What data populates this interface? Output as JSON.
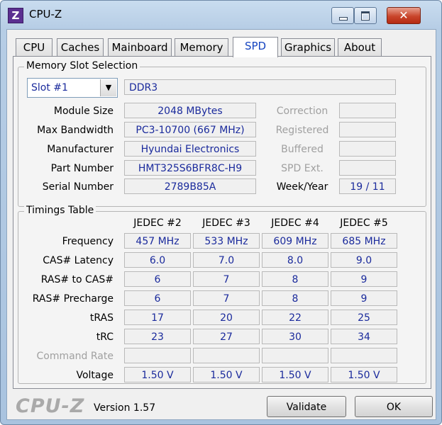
{
  "window": {
    "title": "CPU-Z",
    "icon_letter": "Z",
    "close_glyph": "✕"
  },
  "tabs": [
    "CPU",
    "Caches",
    "Mainboard",
    "Memory",
    "SPD",
    "Graphics",
    "About"
  ],
  "active_tab": "SPD",
  "slot_group": {
    "title": "Memory Slot Selection",
    "slot_selected": "Slot #1",
    "memory_type": "DDR3",
    "fields": [
      {
        "label": "Module Size",
        "value": "2048 MBytes"
      },
      {
        "label": "Max Bandwidth",
        "value": "PC3-10700 (667 MHz)"
      },
      {
        "label": "Manufacturer",
        "value": "Hyundai Electronics"
      },
      {
        "label": "Part Number",
        "value": "HMT325S6BFR8C-H9"
      },
      {
        "label": "Serial Number",
        "value": "2789B85A"
      }
    ],
    "right_fields": [
      {
        "label": "Correction",
        "value": ""
      },
      {
        "label": "Registered",
        "value": ""
      },
      {
        "label": "Buffered",
        "value": ""
      },
      {
        "label": "SPD Ext.",
        "value": ""
      },
      {
        "label": "Week/Year",
        "value": "19 / 11"
      }
    ]
  },
  "timings": {
    "title": "Timings Table",
    "columns": [
      "JEDEC #2",
      "JEDEC #3",
      "JEDEC #4",
      "JEDEC #5"
    ],
    "rows": [
      {
        "label": "Frequency",
        "values": [
          "457 MHz",
          "533 MHz",
          "609 MHz",
          "685 MHz"
        ]
      },
      {
        "label": "CAS# Latency",
        "values": [
          "6.0",
          "7.0",
          "8.0",
          "9.0"
        ]
      },
      {
        "label": "RAS# to CAS#",
        "values": [
          "6",
          "7",
          "8",
          "9"
        ]
      },
      {
        "label": "RAS# Precharge",
        "values": [
          "6",
          "7",
          "8",
          "9"
        ]
      },
      {
        "label": "tRAS",
        "values": [
          "17",
          "20",
          "22",
          "25"
        ]
      },
      {
        "label": "tRC",
        "values": [
          "23",
          "27",
          "30",
          "34"
        ]
      },
      {
        "label": "Command Rate",
        "values": [
          "",
          "",
          "",
          ""
        ]
      },
      {
        "label": "Voltage",
        "values": [
          "1.50 V",
          "1.50 V",
          "1.50 V",
          "1.50 V"
        ]
      }
    ]
  },
  "footer": {
    "brand": "CPU-Z",
    "version": "Version 1.57",
    "validate_label": "Validate",
    "ok_label": "OK"
  }
}
